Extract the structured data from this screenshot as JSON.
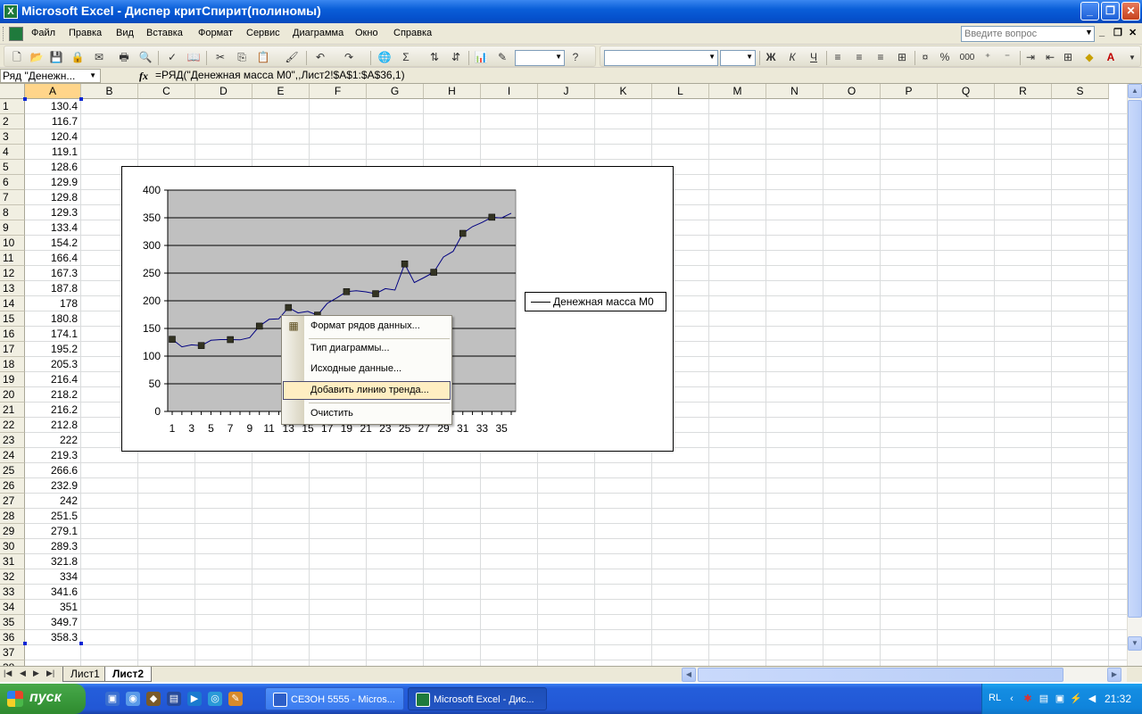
{
  "window": {
    "title": "Microsoft Excel - Диспер критСпирит(полиномы)"
  },
  "menu": {
    "items": [
      "Файл",
      "Правка",
      "Вид",
      "Вставка",
      "Формат",
      "Сервис",
      "Диаграмма",
      "Окно",
      "Справка"
    ],
    "help_placeholder": "Введите вопрос"
  },
  "formula_bar": {
    "name_box": "Ряд \"Денежн...",
    "fx": "fx",
    "formula": "=РЯД(\"Денежная масса M0\",,Лист2!$A$1:$A$36,1)"
  },
  "toolbar": {
    "font_style_buttons": [
      "Ж",
      "К",
      "Ч"
    ],
    "number_buttons": [
      "%",
      "000"
    ]
  },
  "sheet": {
    "columns": [
      "A",
      "B",
      "C",
      "D",
      "E",
      "F",
      "G",
      "H",
      "I",
      "J",
      "K",
      "L",
      "M",
      "N",
      "O",
      "P",
      "Q",
      "R",
      "S"
    ],
    "rows": [
      "1",
      "2",
      "3",
      "4",
      "5",
      "6",
      "7",
      "8",
      "9",
      "10",
      "11",
      "12",
      "13",
      "14",
      "15",
      "16",
      "17",
      "18",
      "19",
      "20",
      "21",
      "22",
      "23",
      "24",
      "25",
      "26",
      "27",
      "28",
      "29",
      "30",
      "31",
      "32",
      "33",
      "34",
      "35",
      "36",
      "37",
      "38"
    ],
    "column_a": [
      "130.4",
      "116.7",
      "120.4",
      "119.1",
      "128.6",
      "129.9",
      "129.8",
      "129.3",
      "133.4",
      "154.2",
      "166.4",
      "167.3",
      "187.8",
      "178",
      "180.8",
      "174.1",
      "195.2",
      "205.3",
      "216.4",
      "218.2",
      "216.2",
      "212.8",
      "222",
      "219.3",
      "266.6",
      "232.9",
      "242",
      "251.5",
      "279.1",
      "289.3",
      "321.8",
      "334",
      "341.6",
      "351",
      "349.7",
      "358.3"
    ]
  },
  "chart_data": {
    "type": "line",
    "title": "",
    "xlabel": "",
    "ylabel": "",
    "x": [
      1,
      2,
      3,
      4,
      5,
      6,
      7,
      8,
      9,
      10,
      11,
      12,
      13,
      14,
      15,
      16,
      17,
      18,
      19,
      20,
      21,
      22,
      23,
      24,
      25,
      26,
      27,
      28,
      29,
      30,
      31,
      32,
      33,
      34,
      35,
      36
    ],
    "x_tick_labels": [
      "1",
      "3",
      "5",
      "7",
      "9",
      "11",
      "13",
      "15",
      "17",
      "19",
      "21",
      "23",
      "25",
      "27",
      "29",
      "31",
      "33",
      "35"
    ],
    "y_tick_labels": [
      "0",
      "50",
      "100",
      "150",
      "200",
      "250",
      "300",
      "350",
      "400"
    ],
    "ylim": [
      0,
      400
    ],
    "grid": "horizontal major gridlines",
    "plot_background": "#c0c0c0",
    "line_color": "#000080",
    "marker_color": "#333322",
    "selected_point_indices": [
      1,
      4,
      7,
      10,
      13,
      16,
      19,
      22,
      25,
      28,
      31,
      34,
      37,
      40,
      43,
      46,
      49,
      52
    ],
    "legend_position": "right",
    "series": [
      {
        "name": "Денежная масса M0",
        "values": [
          130.4,
          116.7,
          120.4,
          119.1,
          128.6,
          129.9,
          129.8,
          129.3,
          133.4,
          154.2,
          166.4,
          167.3,
          187.8,
          178,
          180.8,
          174.1,
          195.2,
          205.3,
          216.4,
          218.2,
          216.2,
          212.8,
          222,
          219.3,
          266.6,
          232.9,
          242,
          251.5,
          279.1,
          289.3,
          321.8,
          334,
          341.6,
          351,
          349.7,
          358.3
        ]
      }
    ]
  },
  "context_menu": {
    "items": [
      "Формат рядов данных...",
      "Тип диаграммы...",
      "Исходные данные...",
      "Добавить линию тренда...",
      "Очистить"
    ],
    "highlighted": "Добавить линию тренда..."
  },
  "sheet_tabs": [
    "Лист1",
    "Лист2"
  ],
  "taskbar": {
    "start_label": "пуск",
    "tasks": [
      "СЕЗОН 5555 - Micros...",
      "Microsoft Excel - Дис..."
    ],
    "language": "RL",
    "clock": "21:32"
  }
}
